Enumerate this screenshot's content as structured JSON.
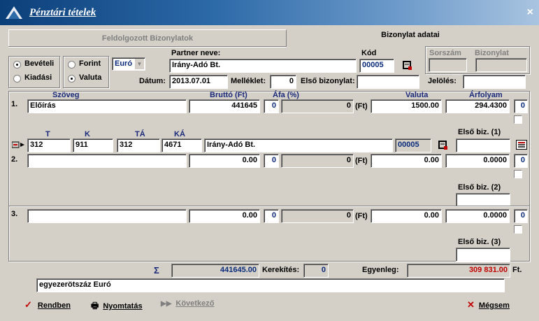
{
  "window": {
    "title": "Pénztári tételek",
    "close": "×"
  },
  "tabs": {
    "processed": "Feldolgozott Bizonylatok",
    "details": "Bizonylat adatai"
  },
  "direction": {
    "income": "Bevételi",
    "expense": "Kiadási",
    "selected": "income"
  },
  "currency_type": {
    "forint": "Forint",
    "valuta": "Valuta",
    "selected": "valuta",
    "currency": "Euró"
  },
  "partner": {
    "label": "Partner neve:",
    "value": "Irány-Adó Bt.",
    "code_label": "Kód",
    "code": "00005"
  },
  "doc": {
    "serial_label": "Sorszám",
    "doc_label": "Bizonylat",
    "serial": "",
    "doc": ""
  },
  "date": {
    "label": "Dátum:",
    "value": "2013.07.01",
    "attach_label": "Melléklet:",
    "attach": "0",
    "first_doc_label": "Első bizonylat:",
    "first_doc": "",
    "mark_label": "Jelölés:",
    "mark": ""
  },
  "headers": {
    "text": "Szöveg",
    "gross": "Bruttó (Ft)",
    "vat": "Áfa  (%)",
    "valuta": "Valuta",
    "rate": "Árfolyam"
  },
  "rows": [
    {
      "num": "1.",
      "text": "Előírás",
      "gross": "441645",
      "vat": "0",
      "vat_amount": "0",
      "ft": "(Ft)",
      "valuta": "1500.00",
      "rate": "294.4300",
      "count": "0",
      "first_biz_label": "Első biz. (1)"
    },
    {
      "num": "2.",
      "text": "",
      "gross": "0.00",
      "vat": "0",
      "vat_amount": "0",
      "ft": "(Ft)",
      "valuta": "0.00",
      "rate": "0.0000",
      "count": "0",
      "first_biz_label": "Első biz. (2)"
    },
    {
      "num": "3.",
      "text": "",
      "gross": "0.00",
      "vat": "0",
      "vat_amount": "0",
      "ft": "(Ft)",
      "valuta": "0.00",
      "rate": "0.0000",
      "count": "0",
      "first_biz_label": "Első biz. (3)"
    }
  ],
  "accounts": {
    "t_label": "T",
    "k_label": "K",
    "ta_label": "TÁ",
    "ka_label": "KÁ",
    "t": "312",
    "k": "911",
    "ta": "312",
    "ka": "4671",
    "partner": "Irány-Adó Bt.",
    "code": "00005"
  },
  "totals": {
    "sigma": "Σ",
    "sum": "441645.00",
    "rounding_label": "Kerekítés:",
    "rounding": "0",
    "balance_label": "Egyenleg:",
    "balance": "309 831.00",
    "ft": "Ft."
  },
  "amount_words": "egyezerötszáz Euró",
  "buttons": {
    "ok": "Rendben",
    "print": "Nyomtatás",
    "next": "Következő",
    "cancel": "Mégsem"
  },
  "colors": {
    "title_start": "#0b3f7a",
    "title_end": "#a9c4e0",
    "label_blue": "#1a2a7a",
    "balance_red": "#c00000"
  }
}
